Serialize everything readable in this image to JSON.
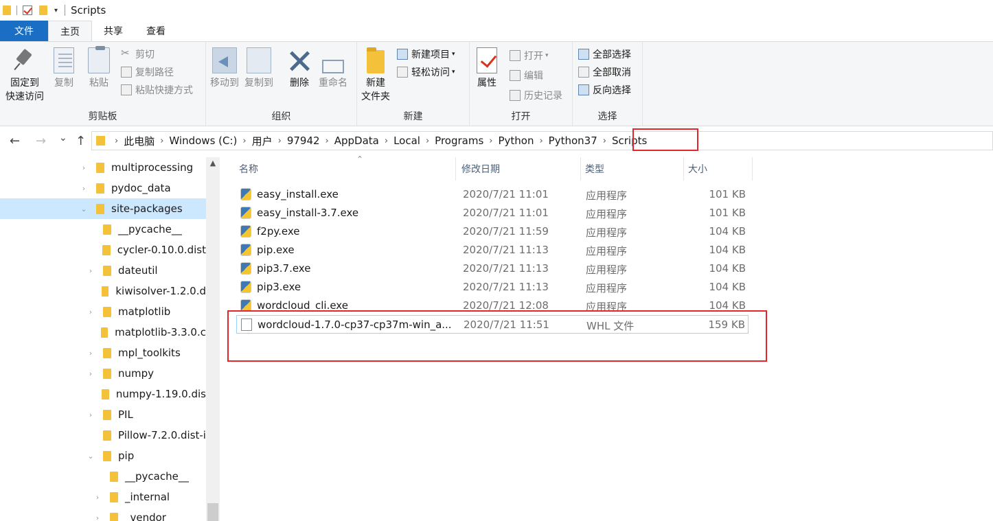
{
  "window": {
    "title": "Scripts"
  },
  "ribbon_tabs": [
    "文件",
    "主页",
    "共享",
    "查看"
  ],
  "ribbon": {
    "clipboard": {
      "label": "剪贴板",
      "pin": "固定到\n快速访问",
      "pin_l1": "固定到",
      "pin_l2": "快速访问",
      "copy": "复制",
      "paste": "粘贴",
      "cut": "剪切",
      "copy_path": "复制路径",
      "paste_shortcut": "粘贴快捷方式"
    },
    "organize": {
      "label": "组织",
      "move_to": "移动到",
      "copy_to": "复制到",
      "delete": "删除",
      "rename": "重命名"
    },
    "new": {
      "label": "新建",
      "new_folder_l1": "新建",
      "new_folder_l2": "文件夹",
      "new_item": "新建项目",
      "easy_access": "轻松访问"
    },
    "open": {
      "label": "打开",
      "properties": "属性",
      "open": "打开",
      "edit": "编辑",
      "history": "历史记录"
    },
    "select": {
      "label": "选择",
      "select_all": "全部选择",
      "select_none": "全部取消",
      "invert": "反向选择"
    }
  },
  "nav": {
    "back": "←",
    "forward": "→",
    "recent": "⌄",
    "up": "↑"
  },
  "breadcrumb": [
    "此电脑",
    "Windows (C:)",
    "用户",
    "97942",
    "AppData",
    "Local",
    "Programs",
    "Python",
    "Python37",
    "Scripts"
  ],
  "tree": [
    {
      "label": "multiprocessing",
      "arrow": "›"
    },
    {
      "label": "pydoc_data",
      "arrow": "›"
    },
    {
      "label": "site-packages",
      "arrow": "⌄"
    },
    {
      "label": "__pycache__",
      "arrow": ""
    },
    {
      "label": "cycler-0.10.0.dist",
      "arrow": ""
    },
    {
      "label": "dateutil",
      "arrow": "›"
    },
    {
      "label": "kiwisolver-1.2.0.d",
      "arrow": ""
    },
    {
      "label": "matplotlib",
      "arrow": "›"
    },
    {
      "label": "matplotlib-3.3.0.c",
      "arrow": ""
    },
    {
      "label": "mpl_toolkits",
      "arrow": "›"
    },
    {
      "label": "numpy",
      "arrow": "›"
    },
    {
      "label": "numpy-1.19.0.dis",
      "arrow": ""
    },
    {
      "label": "PIL",
      "arrow": "›"
    },
    {
      "label": "Pillow-7.2.0.dist-i",
      "arrow": ""
    },
    {
      "label": "pip",
      "arrow": "⌄"
    },
    {
      "label": "__pycache__",
      "arrow": ""
    },
    {
      "label": "_internal",
      "arrow": "›"
    },
    {
      "label": "_vendor",
      "arrow": "›"
    }
  ],
  "columns": {
    "name": "名称",
    "date": "修改日期",
    "type": "类型",
    "size": "大小"
  },
  "files": [
    {
      "name": "easy_install.exe",
      "date": "2020/7/21 11:01",
      "type": "应用程序",
      "size": "101 KB"
    },
    {
      "name": "easy_install-3.7.exe",
      "date": "2020/7/21 11:01",
      "type": "应用程序",
      "size": "101 KB"
    },
    {
      "name": "f2py.exe",
      "date": "2020/7/21 11:59",
      "type": "应用程序",
      "size": "104 KB"
    },
    {
      "name": "pip.exe",
      "date": "2020/7/21 11:13",
      "type": "应用程序",
      "size": "104 KB"
    },
    {
      "name": "pip3.7.exe",
      "date": "2020/7/21 11:13",
      "type": "应用程序",
      "size": "104 KB"
    },
    {
      "name": "pip3.exe",
      "date": "2020/7/21 11:13",
      "type": "应用程序",
      "size": "104 KB"
    },
    {
      "name": "wordcloud_cli.exe",
      "date": "2020/7/21 12:08",
      "type": "应用程序",
      "size": "104 KB"
    },
    {
      "name": "wordcloud-1.7.0-cp37-cp37m-win_a...",
      "date": "2020/7/21 11:51",
      "type": "WHL 文件",
      "size": "159 KB"
    }
  ],
  "colors": {
    "accent": "#1a6fc4",
    "selection": "#cce8ff",
    "annotation": "#e3262b",
    "folder": "#f3c13a"
  }
}
